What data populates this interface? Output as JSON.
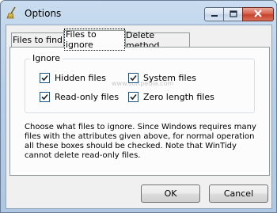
{
  "window": {
    "title": "Options",
    "minimize_icon": "minimize-icon",
    "maximize_icon": "maximize-icon",
    "close_icon": "close-icon"
  },
  "tabs": [
    {
      "label": "Files to find",
      "active": false
    },
    {
      "label": "Files to ignore",
      "active": true
    },
    {
      "label": "Delete method",
      "active": false
    }
  ],
  "ignore_group": {
    "legend": "Ignore",
    "checkboxes": [
      {
        "label": "Hidden files",
        "checked": true
      },
      {
        "label": "System files",
        "checked": true
      },
      {
        "label": "Read-only files",
        "checked": true
      },
      {
        "label": "Zero length files",
        "checked": true
      }
    ]
  },
  "description": "Choose what files to ignore.  Since Windows requires many files with the attributes given above, for normal operation all these boxes should be checked.  Note that WinTidy cannot delete read-only files.",
  "watermark": "www.softpedia.com",
  "buttons": {
    "ok": "OK",
    "cancel": "Cancel"
  },
  "colors": {
    "title_bar": "#b7cfe8",
    "close_button": "#c7412a",
    "dialog_face": "#f0f0f0"
  }
}
